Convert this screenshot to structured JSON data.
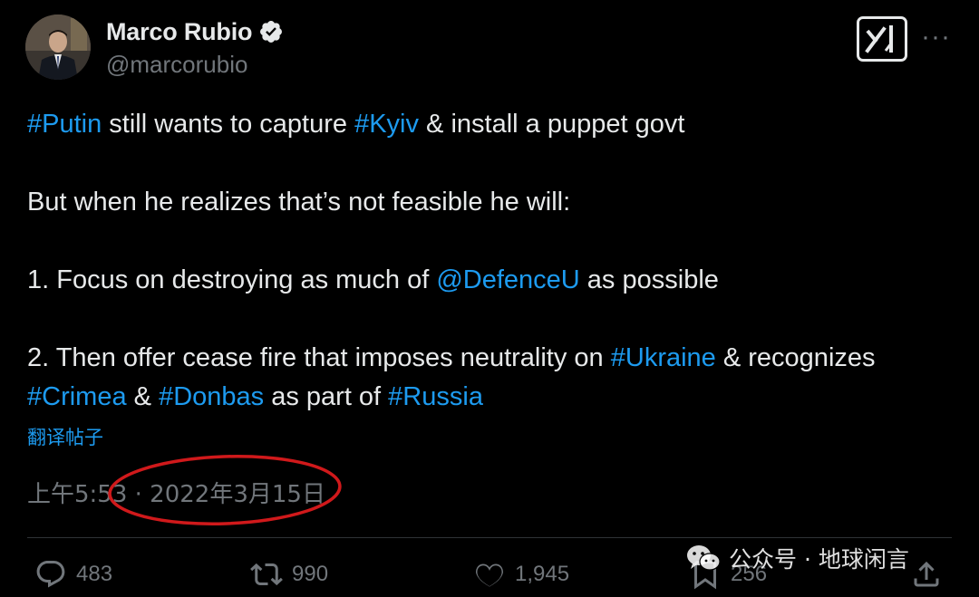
{
  "author": {
    "name": "Marco Rubio",
    "handle": "@marcorubio",
    "verified": true
  },
  "tweet": {
    "line1": [
      {
        "text": "#Putin",
        "link": true
      },
      {
        "text": " still wants to capture ",
        "link": false
      },
      {
        "text": "#Kyiv",
        "link": true
      },
      {
        "text": " & install a puppet govt",
        "link": false
      }
    ],
    "line2": "But when he realizes that’s not feasible he will:",
    "line3": [
      {
        "text": "1. Focus on destroying as much of ",
        "link": false
      },
      {
        "text": "@DefenceU",
        "link": true
      },
      {
        "text": " as possible",
        "link": false
      }
    ],
    "line4": [
      {
        "text": "2. Then offer cease fire that imposes neutrality on ",
        "link": false
      },
      {
        "text": "#Ukraine",
        "link": true
      },
      {
        "text": " & recognizes ",
        "link": false
      },
      {
        "text": "#Crimea",
        "link": true
      },
      {
        "text": " & ",
        "link": false
      },
      {
        "text": "#Donbas",
        "link": true
      },
      {
        "text": " as part of ",
        "link": false
      },
      {
        "text": "#Russia",
        "link": true
      }
    ]
  },
  "translate_label": "翻译帖子",
  "timestamp": "上午5:53 · 2022年3月15日",
  "actions": {
    "replies": "483",
    "reposts": "990",
    "likes": "1,945",
    "bookmarks": "256"
  },
  "watermark": "公众号 · 地球闲言",
  "colors": {
    "background": "#000000",
    "text": "#e7e9ea",
    "link": "#1d9bf0",
    "muted": "#71767b",
    "annotation": "#d0191b"
  },
  "icons": [
    "verified-badge-icon",
    "grok-icon",
    "more-icon",
    "reply-icon",
    "retweet-icon",
    "like-icon",
    "bookmark-icon",
    "share-icon",
    "wechat-icon"
  ]
}
